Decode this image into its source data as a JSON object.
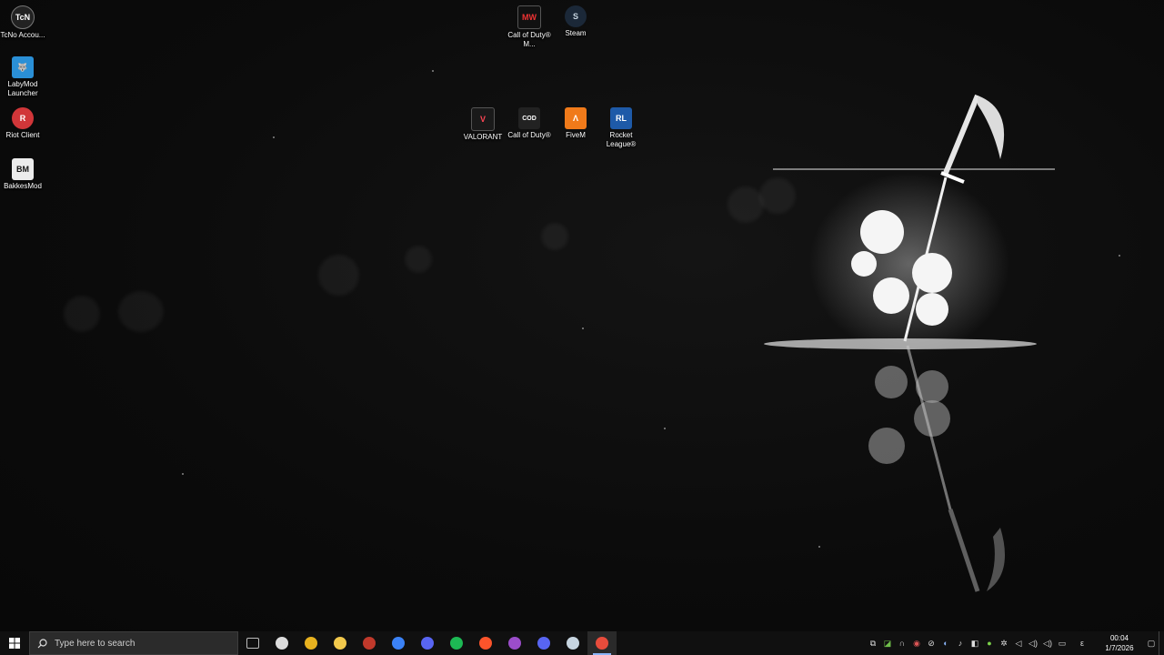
{
  "desktop": {
    "icons_left": [
      {
        "label": "TcNo Accou...",
        "icon": "tcno-icon"
      },
      {
        "label": "LabyMod Launcher",
        "icon": "labymod-icon"
      },
      {
        "label": "Riot Client",
        "icon": "riot-client-icon"
      },
      {
        "label": "BakkesMod",
        "icon": "bakkesmod-icon"
      }
    ],
    "icons_top": [
      {
        "label": "Call of Duty® M...",
        "icon": "cod-mw-icon"
      },
      {
        "label": "Steam",
        "icon": "steam-icon"
      },
      {
        "label": "VALORANT",
        "icon": "valorant-icon"
      },
      {
        "label": "Call of Duty®",
        "icon": "cod-icon"
      },
      {
        "label": "FiveM",
        "icon": "fivem-icon"
      },
      {
        "label": "Rocket League®",
        "icon": "rocket-league-icon"
      }
    ]
  },
  "taskbar": {
    "search_placeholder": "Type here to search",
    "pinned": [
      {
        "name": "task-view-icon",
        "color": "#bbbbbb"
      },
      {
        "name": "steelseries-icon",
        "color": "#dddddd"
      },
      {
        "name": "chrome-icon",
        "color": "#e8b21f"
      },
      {
        "name": "file-explorer-icon",
        "color": "#f2c94c"
      },
      {
        "name": "riot-game-icon",
        "color": "#c0392b"
      },
      {
        "name": "blue-app-icon",
        "color": "#3b82f6"
      },
      {
        "name": "discord-alt-icon",
        "color": "#5865f2"
      },
      {
        "name": "spotify-icon",
        "color": "#1db954"
      },
      {
        "name": "brave-icon",
        "color": "#fb542b"
      },
      {
        "name": "winrar-icon",
        "color": "#9b4dca"
      },
      {
        "name": "discord-icon",
        "color": "#5865f2"
      },
      {
        "name": "steam-taskbar-icon",
        "color": "#c7d5e0"
      },
      {
        "name": "active-app-icon",
        "color": "#e74c3c"
      }
    ],
    "clock": {
      "time": "00:04",
      "date": "1/7/2026"
    },
    "tray_lang": "ε"
  }
}
